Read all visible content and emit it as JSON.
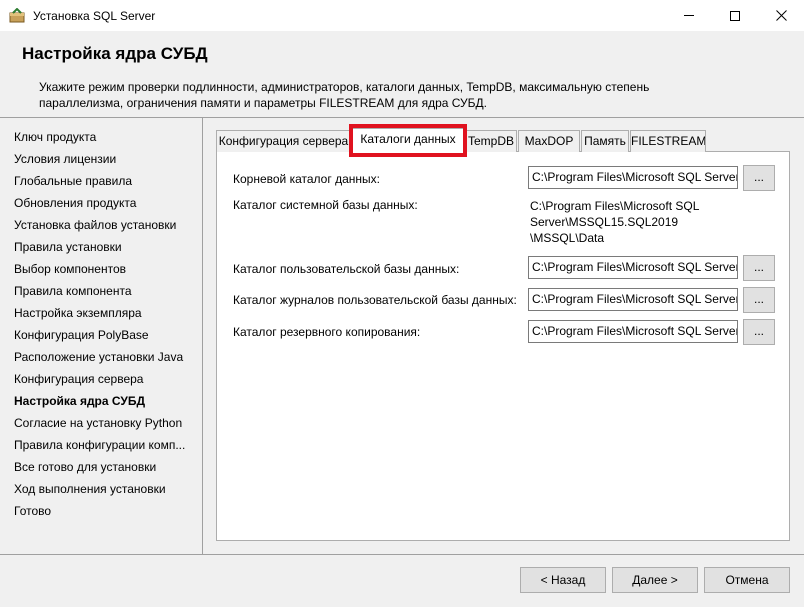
{
  "window": {
    "title": "Установка SQL Server",
    "icon": "sql-setup-box-icon"
  },
  "header": {
    "title": "Настройка ядра СУБД",
    "description": "Укажите режим проверки подлинности, администраторов, каталоги данных, TempDB, максимальную степень параллелизма, ограничения памяти и параметры FILESTREAM для ядра СУБД."
  },
  "nav": {
    "items": [
      {
        "label": "Ключ продукта"
      },
      {
        "label": "Условия лицензии"
      },
      {
        "label": "Глобальные правила"
      },
      {
        "label": "Обновления продукта"
      },
      {
        "label": "Установка файлов установки"
      },
      {
        "label": "Правила установки"
      },
      {
        "label": "Выбор компонентов"
      },
      {
        "label": "Правила компонента"
      },
      {
        "label": "Настройка экземпляра"
      },
      {
        "label": "Конфигурация PolyBase"
      },
      {
        "label": "Расположение установки Java"
      },
      {
        "label": "Конфигурация сервера"
      },
      {
        "label": "Настройка ядра СУБД"
      },
      {
        "label": "Согласие на установку Python"
      },
      {
        "label": "Правила конфигурации комп..."
      },
      {
        "label": "Все готово для установки"
      },
      {
        "label": "Ход выполнения установки"
      },
      {
        "label": "Готово"
      }
    ],
    "active_index": 12
  },
  "tabs": {
    "items": [
      {
        "label": "Конфигурация сервера"
      },
      {
        "label": "Каталоги данных"
      },
      {
        "label": "TempDB"
      },
      {
        "label": "MaxDOP"
      },
      {
        "label": "Память"
      },
      {
        "label": "FILESTREAM"
      }
    ],
    "selected_index": 1,
    "highlight_color": "#e0121f"
  },
  "data_dirs": {
    "root_label": "Корневой каталог данных:",
    "root_value": "C:\\Program Files\\Microsoft SQL Server\\",
    "system_label": "Каталог системной базы данных:",
    "system_value_lines": [
      "C:\\Program Files\\Microsoft SQL",
      "Server\\MSSQL15.SQL2019",
      "\\MSSQL\\Data"
    ],
    "user_db_label": "Каталог пользовательской базы данных:",
    "user_db_value": "C:\\Program Files\\Microsoft SQL Server\\",
    "user_log_label": "Каталог журналов пользовательской базы данных:",
    "user_log_value": "C:\\Program Files\\Microsoft SQL Server\\",
    "backup_label": "Каталог резервного копирования:",
    "backup_value": "C:\\Program Files\\Microsoft SQL Server\\",
    "browse_label": "..."
  },
  "footer": {
    "back_label": "< Назад",
    "next_label": "Далее >",
    "cancel_label": "Отмена"
  }
}
